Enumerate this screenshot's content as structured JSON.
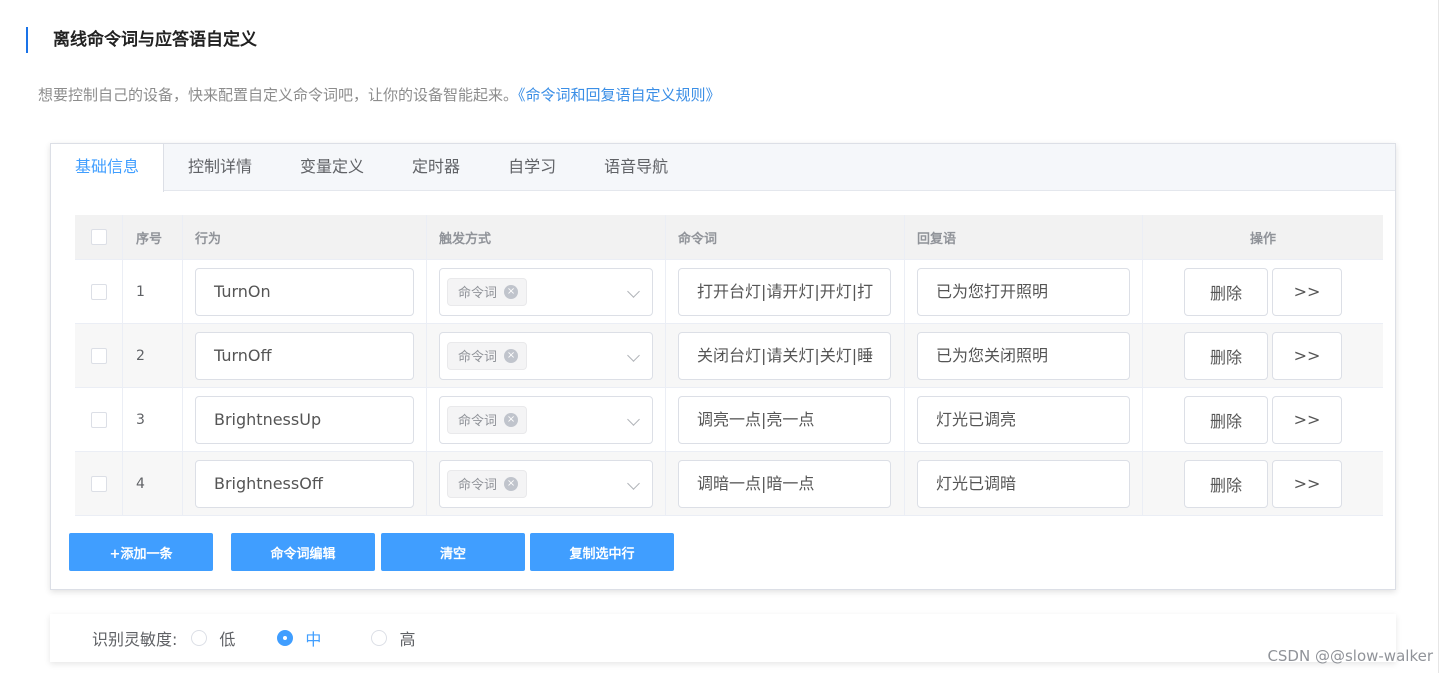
{
  "header": {
    "title": "离线命令词与应答语自定义",
    "description": "想要控制自己的设备，快来配置自定义命令词吧，让你的设备智能起来。",
    "rules_link": "《命令词和回复语自定义规则》"
  },
  "tabs": [
    "基础信息",
    "控制详情",
    "变量定义",
    "定时器",
    "自学习",
    "语音导航"
  ],
  "table": {
    "columns": [
      "序号",
      "行为",
      "触发方式",
      "命令词",
      "回复语",
      "操作"
    ],
    "rows": [
      {
        "no": "1",
        "action": "TurnOn",
        "trigger": "命令词",
        "command": "打开台灯|请开灯|开灯|打",
        "reply": "已为您打开照明"
      },
      {
        "no": "2",
        "action": "TurnOff",
        "trigger": "命令词",
        "command": "关闭台灯|请关灯|关灯|睡",
        "reply": "已为您关闭照明"
      },
      {
        "no": "3",
        "action": "BrightnessUp",
        "trigger": "命令词",
        "command": "调亮一点|亮一点",
        "reply": "灯光已调亮"
      },
      {
        "no": "4",
        "action": "BrightnessOff",
        "trigger": "命令词",
        "command": "调暗一点|暗一点",
        "reply": "灯光已调暗"
      }
    ],
    "delete_label": "删除",
    "more_label": ">>"
  },
  "actions": {
    "add": "+添加一条",
    "edit": "命令词编辑",
    "clear": "清空",
    "copy": "复制选中行"
  },
  "sensitivity": {
    "label": "识别灵敏度:",
    "options": [
      "低",
      "中",
      "高"
    ],
    "selected": "中"
  },
  "watermark": "CSDN @@slow-walker",
  "colors": {
    "accent": "#409eff",
    "title_bar": "#1a73e8",
    "link": "#3a8ee6"
  }
}
